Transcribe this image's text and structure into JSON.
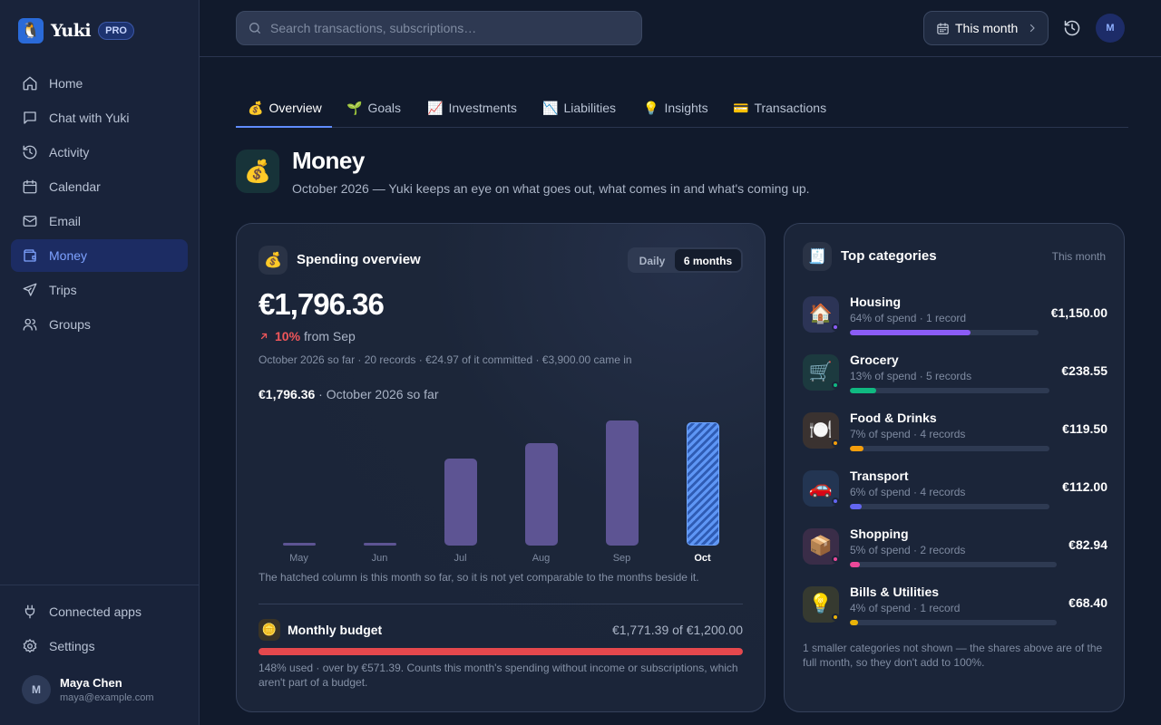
{
  "app": {
    "name": "Yuki",
    "badge": "PRO"
  },
  "sidebar": {
    "items": [
      {
        "label": "Home",
        "icon": "home-icon"
      },
      {
        "label": "Chat with Yuki",
        "icon": "chat-icon"
      },
      {
        "label": "Activity",
        "icon": "history-icon"
      },
      {
        "label": "Calendar",
        "icon": "calendar-icon"
      },
      {
        "label": "Email",
        "icon": "mail-icon"
      },
      {
        "label": "Money",
        "icon": "wallet-icon",
        "active": true
      },
      {
        "label": "Trips",
        "icon": "plane-icon"
      },
      {
        "label": "Groups",
        "icon": "users-icon"
      }
    ],
    "bottom": [
      {
        "label": "Connected apps",
        "icon": "plug-icon"
      },
      {
        "label": "Settings",
        "icon": "gear-icon"
      }
    ],
    "user": {
      "initial": "M",
      "name": "Maya Chen",
      "email": "maya@example.com"
    }
  },
  "topbar": {
    "search_placeholder": "Search transactions, subscriptions…",
    "period_label": "This month",
    "avatar_initial": "M"
  },
  "tabs": [
    {
      "label": "Overview",
      "emoji": "💰",
      "active": true
    },
    {
      "label": "Goals",
      "emoji": "🌱"
    },
    {
      "label": "Investments",
      "emoji": "📈"
    },
    {
      "label": "Liabilities",
      "emoji": "📉"
    },
    {
      "label": "Insights",
      "emoji": "💡"
    },
    {
      "label": "Transactions",
      "emoji": "💳"
    }
  ],
  "page": {
    "emoji": "💰",
    "title": "Money",
    "subtitle": "October 2026 — Yuki keeps an eye on what goes out, what comes in and what's coming up."
  },
  "spending": {
    "emoji": "💰",
    "title": "Spending overview",
    "toggle_options": [
      "Daily",
      "6 months"
    ],
    "toggle_selected": "6 months",
    "total": "€1,796.36",
    "delta_pct": "10%",
    "delta_label": "from Sep",
    "meta": "October 2026 so far · 20 records · €24.97 of it committed · €3,900.00 came in",
    "sofar_amount": "€1,796.36",
    "sofar_label": " · October 2026 so far",
    "note": "The hatched column is this month so far, so it is not yet comparable to the months beside it."
  },
  "chart_data": {
    "type": "bar",
    "categories": [
      "May",
      "Jun",
      "Jul",
      "Aug",
      "Sep",
      "Oct"
    ],
    "values": [
      25,
      25,
      1270,
      1500,
      1820,
      1796.36
    ],
    "current_index": 5,
    "ylim": [
      0,
      1850
    ],
    "colors": {
      "bar": "#5d5493",
      "current": "#5e96f5"
    }
  },
  "budget": {
    "emoji": "🪙",
    "title": "Monthly budget",
    "value": "€1,771.39 of €1,200.00",
    "fill_fraction": 1.0,
    "note": "148% used · over by €571.39. Counts this month's spending without income or subscriptions, which aren't part of a budget."
  },
  "categories": {
    "emoji": "🧾",
    "title": "Top categories",
    "range": "This month",
    "items": [
      {
        "name": "Housing",
        "emoji": "🏠",
        "sub": "64% of spend · 1 record",
        "amount": "€1,150.00",
        "share": 0.64,
        "color": "#8b5cf6",
        "bg": "#2c3456"
      },
      {
        "name": "Grocery",
        "emoji": "🛒",
        "sub": "13% of spend · 5 records",
        "amount": "€238.55",
        "share": 0.13,
        "color": "#10b981",
        "bg": "#1c3a3f"
      },
      {
        "name": "Food & Drinks",
        "emoji": "🍽️",
        "sub": "7% of spend · 4 records",
        "amount": "€119.50",
        "share": 0.07,
        "color": "#f59e0b",
        "bg": "#3a3230"
      },
      {
        "name": "Transport",
        "emoji": "🚗",
        "sub": "6% of spend · 4 records",
        "amount": "€112.00",
        "share": 0.06,
        "color": "#6366f1",
        "bg": "#233552"
      },
      {
        "name": "Shopping",
        "emoji": "📦",
        "sub": "5% of spend · 2 records",
        "amount": "€82.94",
        "share": 0.05,
        "color": "#ec4899",
        "bg": "#3a2d48"
      },
      {
        "name": "Bills & Utilities",
        "emoji": "💡",
        "sub": "4% of spend · 1 record",
        "amount": "€68.40",
        "share": 0.04,
        "color": "#eab308",
        "bg": "#363a30"
      }
    ],
    "note": "1 smaller categories not shown — the shares above are of the full month, so they don't add to 100%."
  }
}
